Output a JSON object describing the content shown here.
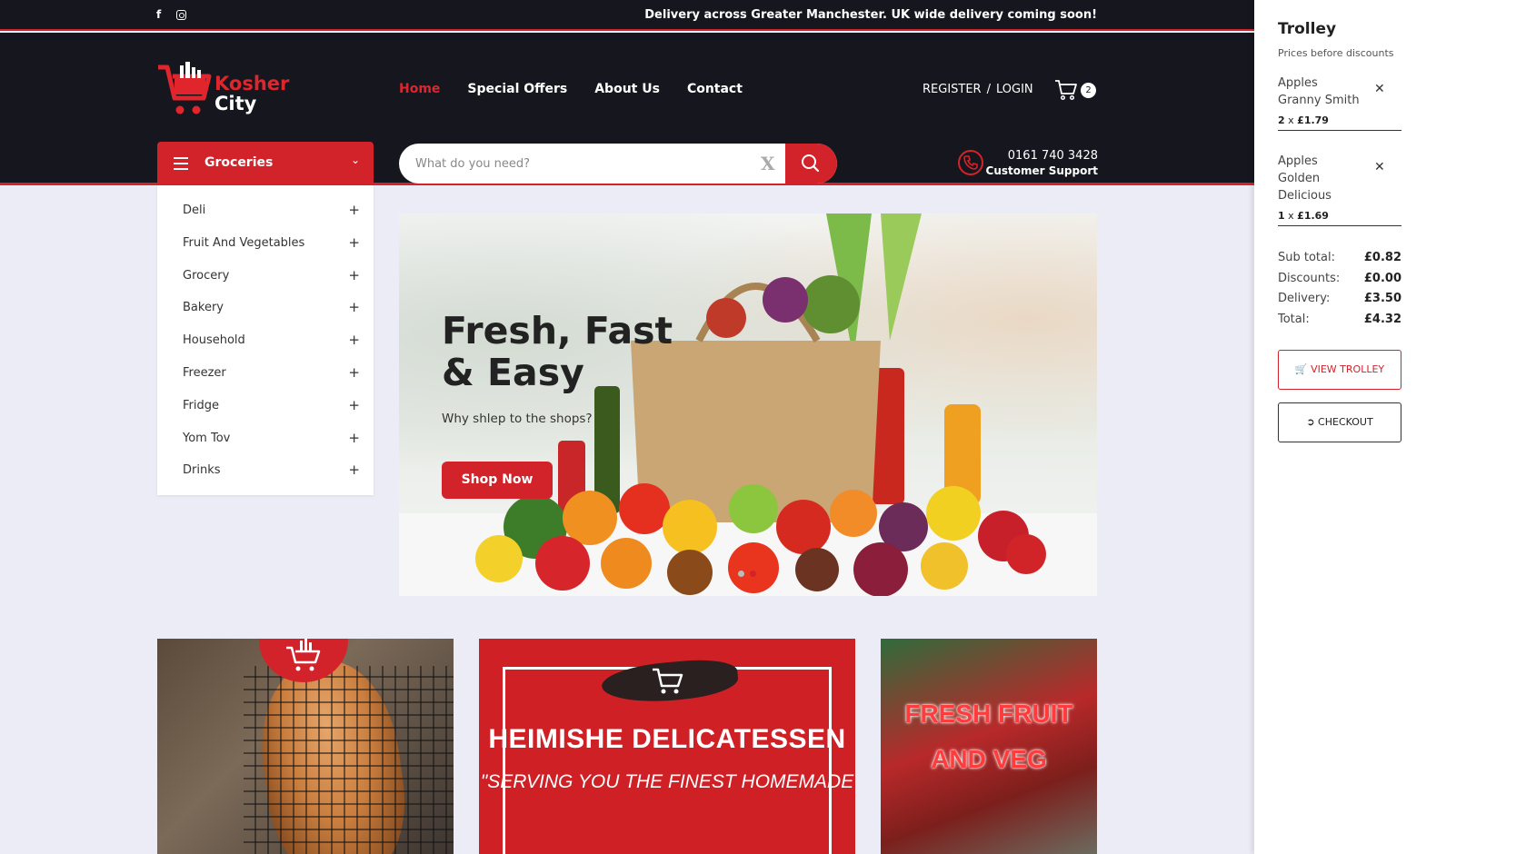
{
  "topbar": {
    "social": [
      {
        "icon": "facebook-icon",
        "glyph": "f"
      },
      {
        "icon": "instagram-icon",
        "glyph": ""
      }
    ],
    "notice": "Delivery across Greater Manchester. UK wide delivery coming soon!"
  },
  "header": {
    "logo": {
      "line1": "Kosher",
      "line2": "City"
    },
    "nav": [
      {
        "label": "Home",
        "active": true
      },
      {
        "label": "Special Offers",
        "active": false
      },
      {
        "label": "About Us",
        "active": false
      },
      {
        "label": "Contact",
        "active": false
      }
    ],
    "account": {
      "register": "REGISTER",
      "separator": "/",
      "login": "LOGIN"
    },
    "cart": {
      "icon": "cart-icon",
      "count": "2"
    },
    "categories_button": {
      "label": "Groceries",
      "icon": "menu-icon"
    },
    "search": {
      "placeholder": "What do you need?",
      "clear": "X",
      "icon": "search-icon"
    },
    "support": {
      "phone": "0161 740 3428",
      "label": "Customer Support",
      "icon": "phone-icon"
    }
  },
  "categories": [
    {
      "label": "Deli"
    },
    {
      "label": "Fruit And Vegetables"
    },
    {
      "label": "Grocery"
    },
    {
      "label": "Bakery"
    },
    {
      "label": "Household"
    },
    {
      "label": "Freezer"
    },
    {
      "label": "Fridge"
    },
    {
      "label": "Yom Tov"
    },
    {
      "label": "Drinks"
    }
  ],
  "hero": {
    "title_line1": "Fresh, Fast",
    "title_line2": "& Easy",
    "subtitle": "Why shlep to the shops?",
    "button": "Shop Now"
  },
  "tiles": [
    {
      "name": "bakery"
    },
    {
      "title": "HEIMISHE DELICATESSEN",
      "quote": "\"SERVING YOU THE FINEST HOMEMADE"
    },
    {
      "line1": "FRESH FRUIT",
      "line2": "AND VEG"
    }
  ],
  "trolley": {
    "title": "Trolley",
    "note": "Prices before discounts",
    "items": [
      {
        "name": "Apples Granny Smith",
        "qty": "2",
        "x": "x",
        "price": "£1.79"
      },
      {
        "name": "Apples Golden Delicious",
        "qty": "1",
        "x": "x",
        "price": "£1.69"
      }
    ],
    "totals": [
      {
        "label": "Sub total:",
        "value": "£0.82"
      },
      {
        "label": "Discounts:",
        "value": "£0.00"
      },
      {
        "label": "Delivery:",
        "value": "£3.50"
      },
      {
        "label": "Total:",
        "value": "£4.32"
      }
    ],
    "view_button": "VIEW TROLLEY",
    "checkout_button": "CHECKOUT"
  },
  "colors": {
    "accent": "#d3232a",
    "dark": "#15161e",
    "page_bg": "#ececf6"
  }
}
